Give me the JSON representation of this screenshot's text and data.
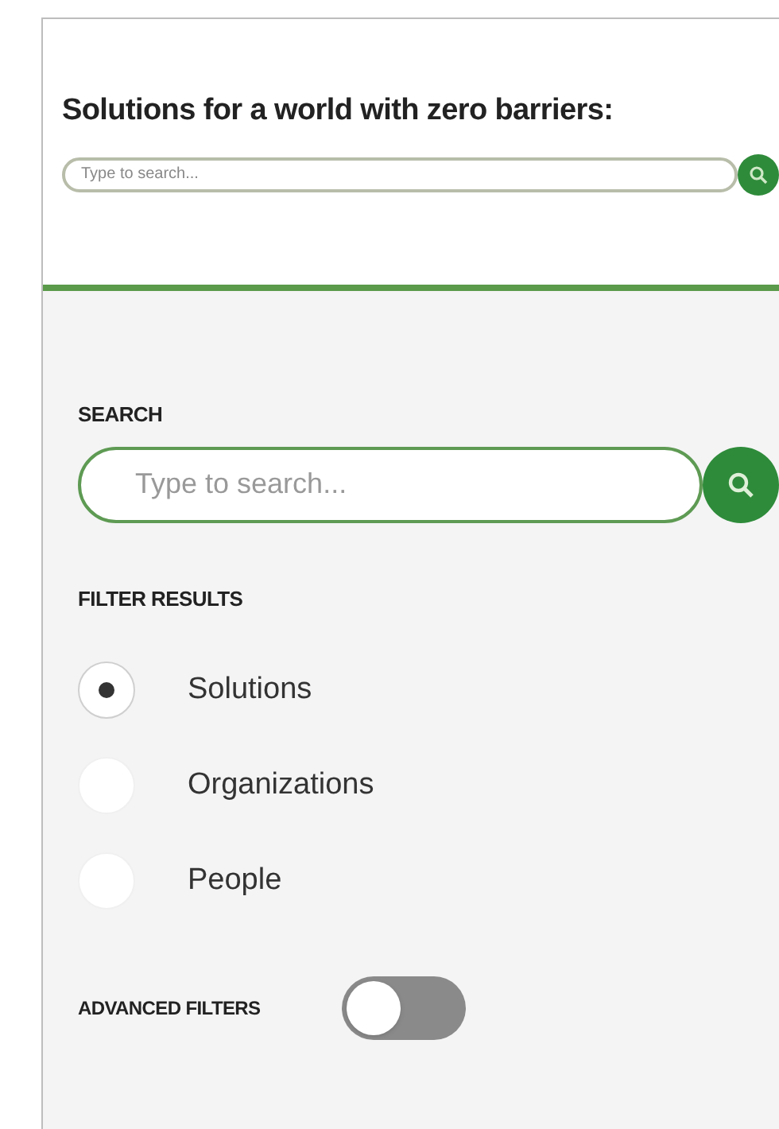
{
  "header": {
    "title": "Solutions for a world with zero barriers:",
    "search": {
      "placeholder": "Type to search..."
    }
  },
  "search_section": {
    "label": "SEARCH",
    "search": {
      "placeholder": "Type to search..."
    }
  },
  "filter_section": {
    "label": "FILTER RESULTS",
    "options": [
      {
        "label": "Solutions",
        "selected": true
      },
      {
        "label": "Organizations",
        "selected": false
      },
      {
        "label": "People",
        "selected": false
      }
    ]
  },
  "advanced_filters": {
    "label": "ADVANCED FILTERS",
    "on": false
  }
}
